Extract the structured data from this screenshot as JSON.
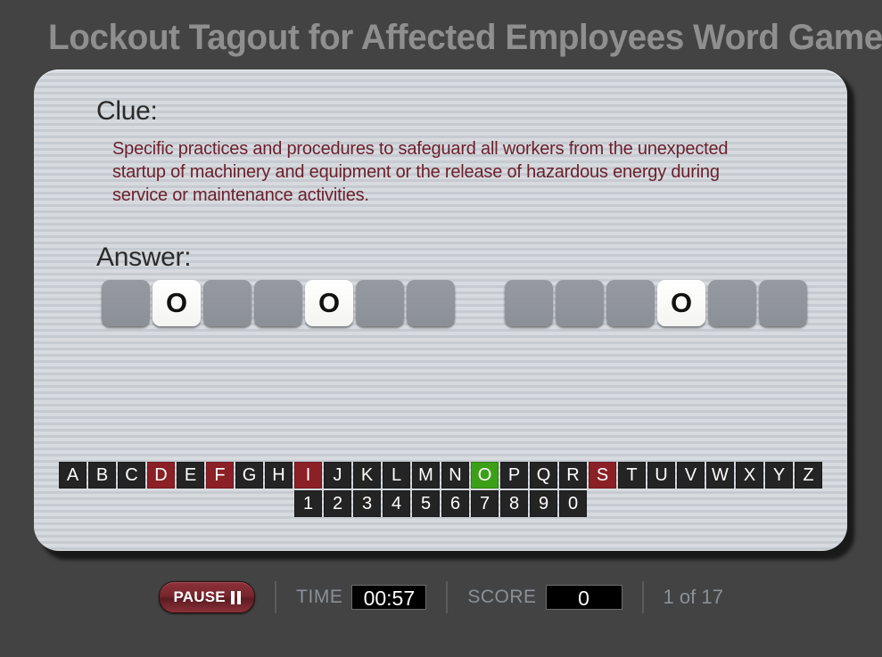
{
  "title": "Lockout Tagout for Affected Employees Word Game",
  "card": {
    "clue_label": "Clue:",
    "clue_text": "Specific practices and procedures to safeguard all workers from the unexpected startup of machinery and equipment or the release of hazardous energy during service or maintenance activities.",
    "answer_label": "Answer:",
    "answer": {
      "words": [
        {
          "tiles": [
            "",
            "O",
            "",
            "",
            "O",
            "",
            ""
          ]
        },
        {
          "tiles": [
            "",
            "",
            "",
            "O",
            "",
            ""
          ]
        }
      ]
    },
    "keyboard": {
      "letters": [
        {
          "key": "A",
          "state": "default"
        },
        {
          "key": "B",
          "state": "default"
        },
        {
          "key": "C",
          "state": "default"
        },
        {
          "key": "D",
          "state": "wrong"
        },
        {
          "key": "E",
          "state": "default"
        },
        {
          "key": "F",
          "state": "wrong"
        },
        {
          "key": "G",
          "state": "default"
        },
        {
          "key": "H",
          "state": "default"
        },
        {
          "key": "I",
          "state": "wrong"
        },
        {
          "key": "J",
          "state": "default"
        },
        {
          "key": "K",
          "state": "default"
        },
        {
          "key": "L",
          "state": "default"
        },
        {
          "key": "M",
          "state": "default"
        },
        {
          "key": "N",
          "state": "default"
        },
        {
          "key": "O",
          "state": "right"
        },
        {
          "key": "P",
          "state": "default"
        },
        {
          "key": "Q",
          "state": "default"
        },
        {
          "key": "R",
          "state": "default"
        },
        {
          "key": "S",
          "state": "wrong"
        },
        {
          "key": "T",
          "state": "default"
        },
        {
          "key": "U",
          "state": "default"
        },
        {
          "key": "V",
          "state": "default"
        },
        {
          "key": "W",
          "state": "default"
        },
        {
          "key": "X",
          "state": "default"
        },
        {
          "key": "Y",
          "state": "default"
        },
        {
          "key": "Z",
          "state": "default"
        }
      ],
      "numbers": [
        {
          "key": "1",
          "state": "default"
        },
        {
          "key": "2",
          "state": "default"
        },
        {
          "key": "3",
          "state": "default"
        },
        {
          "key": "4",
          "state": "default"
        },
        {
          "key": "5",
          "state": "default"
        },
        {
          "key": "6",
          "state": "default"
        },
        {
          "key": "7",
          "state": "default"
        },
        {
          "key": "8",
          "state": "default"
        },
        {
          "key": "9",
          "state": "default"
        },
        {
          "key": "0",
          "state": "default"
        }
      ]
    }
  },
  "footer": {
    "pause_label": "PAUSE",
    "pause_icon": "pause-icon",
    "time_label": "TIME",
    "time_value": "00:57",
    "score_label": "SCORE",
    "score_value": "0",
    "progress": "1 of 17"
  },
  "colors": {
    "page_background": "#434343",
    "title_text": "#8f8f8f",
    "clue_text": "#6b1f2c",
    "key_default": "#242424",
    "key_wrong": "#8b2026",
    "key_right": "#3ba017",
    "pause_red": "#78262c",
    "stat_label": "#8b9097"
  }
}
